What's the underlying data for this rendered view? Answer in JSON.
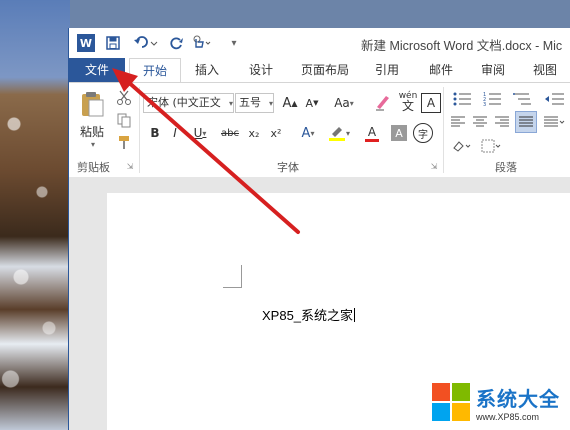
{
  "title_bar": {
    "word_logo": "W",
    "title": "新建 Microsoft Word 文档.docx - Mic"
  },
  "tabs": [
    {
      "label": "文件"
    },
    {
      "label": "开始"
    },
    {
      "label": "插入"
    },
    {
      "label": "设计"
    },
    {
      "label": "页面布局"
    },
    {
      "label": "引用"
    },
    {
      "label": "邮件"
    },
    {
      "label": "审阅"
    },
    {
      "label": "视图"
    }
  ],
  "ribbon": {
    "clipboard": {
      "paste_label": "粘贴",
      "group_label": "剪贴板"
    },
    "font": {
      "font_name": "宋体 (中文正文",
      "font_size": "五号",
      "group_label": "字体",
      "buttons": [
        "B",
        "I",
        "U",
        "abc",
        "x₂",
        "x²",
        "A",
        "A",
        "A",
        "Aa",
        "wén",
        "A",
        "字"
      ]
    },
    "paragraph": {
      "group_label": "段落"
    }
  },
  "document": {
    "text": "XP85_系统之家"
  },
  "watermark": {
    "brand": "系统大全",
    "url": "www.XP85.com"
  },
  "colors": {
    "accent": "#2b579a",
    "annotation_arrow": "#d62020"
  }
}
